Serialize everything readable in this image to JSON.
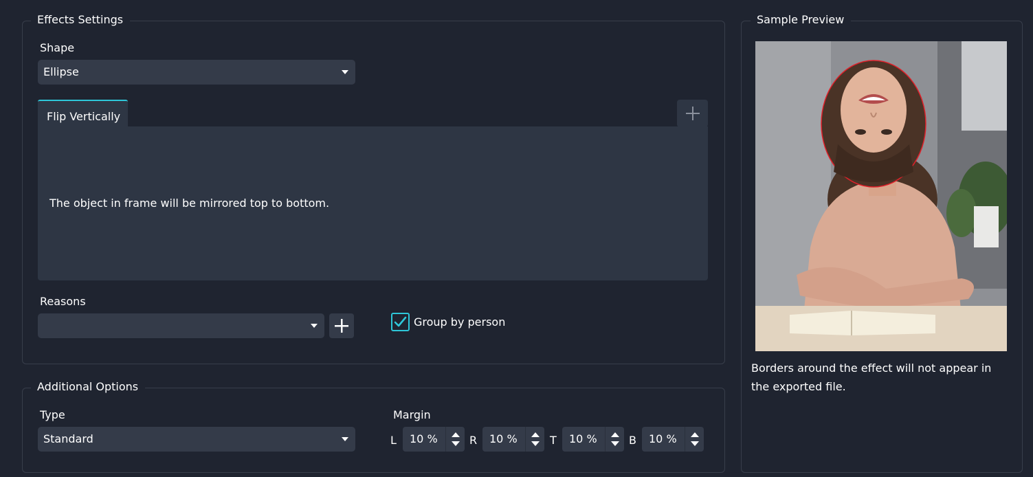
{
  "effects_settings": {
    "title": "Effects Settings",
    "shape_label": "Shape",
    "shape_value": "Ellipse",
    "tabs": [
      {
        "label": "Flip Vertically",
        "active": true
      }
    ],
    "tab_description": "The object in frame will be mirrored top to bottom.",
    "reasons_label": "Reasons",
    "reasons_value": "",
    "group_by_person": {
      "label": "Group by person",
      "checked": true
    }
  },
  "additional_options": {
    "title": "Additional Options",
    "type_label": "Type",
    "type_value": "Standard",
    "margin_label": "Margin",
    "margins": [
      {
        "side": "L",
        "value": "10 %"
      },
      {
        "side": "R",
        "value": "10 %"
      },
      {
        "side": "T",
        "value": "10 %"
      },
      {
        "side": "B",
        "value": "10 %"
      }
    ]
  },
  "sample_preview": {
    "title": "Sample Preview",
    "note": "Borders around the effect will not appear in the exported file."
  },
  "colors": {
    "background": "#1f2430",
    "panel": "#2e3644",
    "control": "#343b49",
    "accent": "#2ec7d9",
    "effect_border": "#e0202a"
  },
  "icons": [
    "caret-down-icon",
    "plus-icon",
    "checkmark-icon",
    "spin-up-icon",
    "spin-down-icon"
  ]
}
